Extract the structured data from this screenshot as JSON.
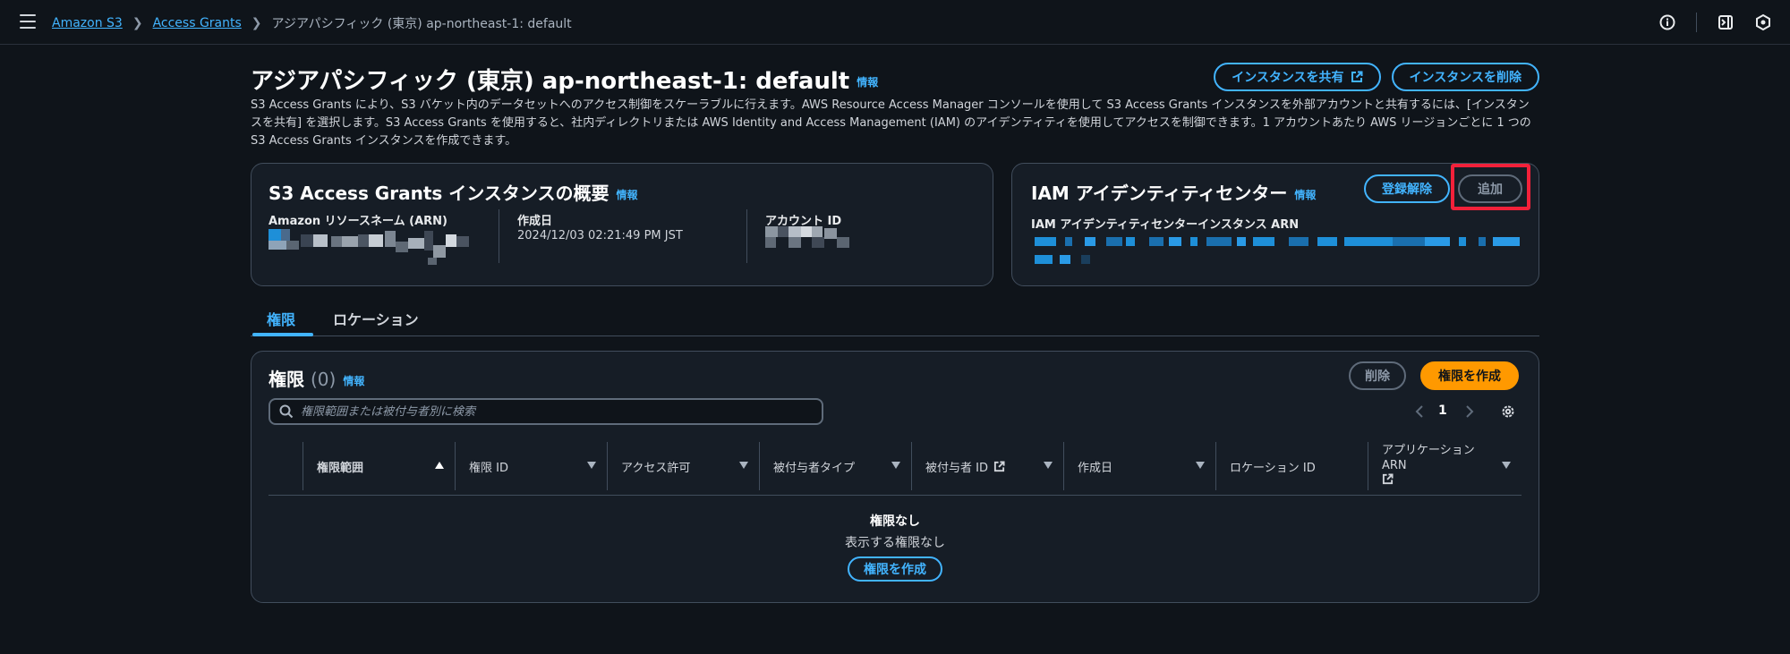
{
  "breadcrumb": {
    "items": [
      "Amazon S3",
      "Access Grants"
    ],
    "current": "アジアパシフィック (東京) ap-northeast-1: default"
  },
  "page": {
    "title": "アジアパシフィック (東京) ap-northeast-1: default",
    "info_label": "情報",
    "share_button": "インスタンスを共有",
    "delete_button": "インスタンスを削除",
    "description": "S3 Access Grants により、S3 バケット内のデータセットへのアクセス制御をスケーラブルに行えます。AWS Resource Access Manager コンソールを使用して S3 Access Grants インスタンスを外部アカウントと共有するには、[インスタンスを共有] を選択します。S3 Access Grants を使用すると、社内ディレクトリまたは AWS Identity and Access Management (IAM) のアイデンティティを使用してアクセスを制御できます。1 アカウントあたり AWS リージョンごとに 1 つの S3 Access Grants インスタンスを作成できます。"
  },
  "overview": {
    "title": "S3 Access Grants インスタンスの概要",
    "info_label": "情報",
    "arn_label": "Amazon リソースネーム (ARN)",
    "created_label": "作成日",
    "created_value": "2024/12/03 02:21:49 PM JST",
    "account_label": "アカウント ID"
  },
  "identity_center": {
    "title": "IAM アイデンティティセンター",
    "info_label": "情報",
    "deregister_button": "登録解除",
    "add_button": "追加",
    "arn_label": "IAM アイデンティティセンターインスタンス ARN"
  },
  "tabs": [
    "権限",
    "ロケーション"
  ],
  "grants": {
    "title": "権限",
    "count": "(0)",
    "info_label": "情報",
    "delete_button": "削除",
    "create_button": "権限を作成",
    "search_placeholder": "権限範囲または被付与者別に検索",
    "page_number": "1",
    "columns": {
      "scope": "権限範囲",
      "grant_id": "権限 ID",
      "permission": "アクセス許可",
      "grantee_type": "被付与者タイプ",
      "grantee_id": "被付与者 ID",
      "created": "作成日",
      "location_id": "ロケーション ID",
      "app_arn_1": "アプリケーション",
      "app_arn_2": "ARN"
    },
    "empty_title": "権限なし",
    "empty_sub": "表示する権限なし",
    "empty_create_button": "権限を作成"
  },
  "colors": {
    "accent": "#42b4ff",
    "primary": "#ff9900",
    "highlight": "#f2213a",
    "background": "#0f141a",
    "card": "#161d26"
  },
  "icons": [
    "menu-icon",
    "chevron-right-icon",
    "info-circle-icon",
    "panel-icon",
    "settings-badge-icon",
    "external-link-icon",
    "search-icon",
    "chevron-left-icon",
    "gear-icon",
    "sort-asc-icon",
    "sort-icon"
  ]
}
